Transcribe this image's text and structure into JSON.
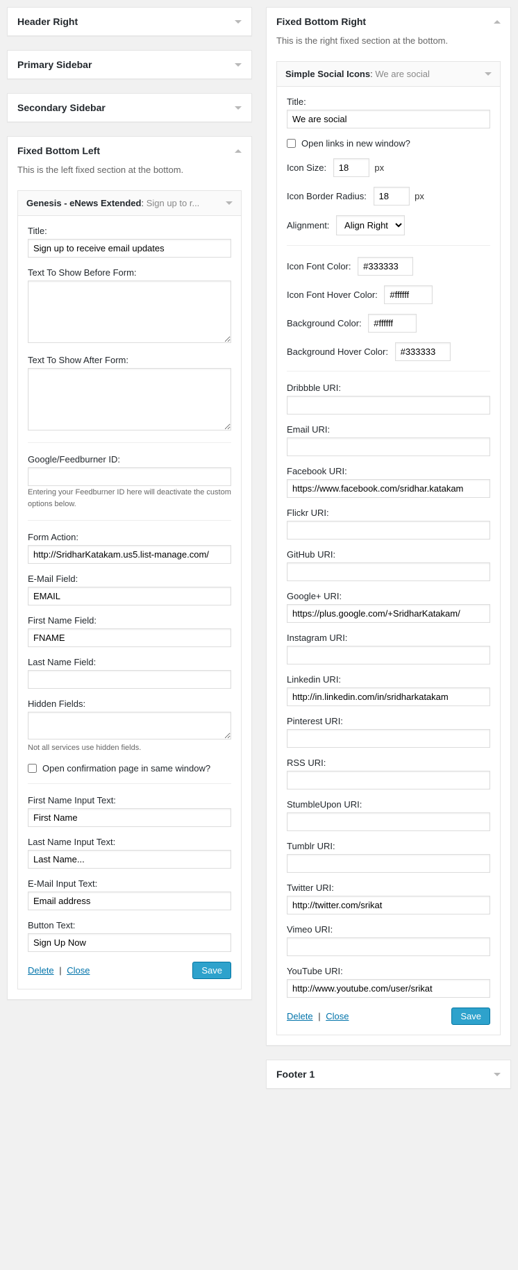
{
  "left": {
    "areas": {
      "header_right": {
        "title": "Header Right"
      },
      "primary_sidebar": {
        "title": "Primary Sidebar"
      },
      "secondary_sidebar": {
        "title": "Secondary Sidebar"
      },
      "fixed_bottom_left": {
        "title": "Fixed Bottom Left",
        "desc": "This is the left fixed section at the bottom."
      }
    },
    "enews": {
      "header_name": "Genesis - eNews Extended",
      "header_sub": "Sign up to r...",
      "labels": {
        "title": "Title:",
        "before": "Text To Show Before Form:",
        "after": "Text To Show After Form:",
        "feedburner": "Google/Feedburner ID:",
        "feedburner_help": "Entering your Feedburner ID here will deactivate the custom options below.",
        "form_action": "Form Action:",
        "email_field": "E-Mail Field:",
        "fname_field": "First Name Field:",
        "lname_field": "Last Name Field:",
        "hidden": "Hidden Fields:",
        "hidden_help": "Not all services use hidden fields.",
        "open_same": "Open confirmation page in same window?",
        "fname_text": "First Name Input Text:",
        "lname_text": "Last Name Input Text:",
        "email_text": "E-Mail Input Text:",
        "button_text": "Button Text:"
      },
      "values": {
        "title": "Sign up to receive email updates",
        "before": "",
        "after": "",
        "feedburner": "",
        "form_action": "http://SridharKatakam.us5.list-manage.com/",
        "email_field": "EMAIL",
        "fname_field": "FNAME",
        "lname_field": "",
        "hidden": "",
        "fname_text": "First Name",
        "lname_text": "Last Name...",
        "email_text": "Email address",
        "button_text": "Sign Up Now"
      },
      "actions": {
        "delete": "Delete",
        "close": "Close",
        "save": "Save"
      }
    }
  },
  "right": {
    "area": {
      "title": "Fixed Bottom Right",
      "desc": "This is the right fixed section at the bottom."
    },
    "social": {
      "header_name": "Simple Social Icons",
      "header_sub": "We are social",
      "labels": {
        "title": "Title:",
        "open_new": "Open links in new window?",
        "icon_size": "Icon Size:",
        "px": "px",
        "border_radius": "Icon Border Radius:",
        "alignment": "Alignment:",
        "font_color": "Icon Font Color:",
        "font_hover": "Icon Font Hover Color:",
        "bg_color": "Background Color:",
        "bg_hover": "Background Hover Color:",
        "dribbble": "Dribbble URI:",
        "email": "Email URI:",
        "facebook": "Facebook URI:",
        "flickr": "Flickr URI:",
        "github": "GitHub URI:",
        "gplus": "Google+ URI:",
        "instagram": "Instagram URI:",
        "linkedin": "Linkedin URI:",
        "pinterest": "Pinterest URI:",
        "rss": "RSS URI:",
        "stumble": "StumbleUpon URI:",
        "tumblr": "Tumblr URI:",
        "twitter": "Twitter URI:",
        "vimeo": "Vimeo URI:",
        "youtube": "YouTube URI:"
      },
      "values": {
        "title": "We are social",
        "icon_size": "18",
        "border_radius": "18",
        "alignment": "Align Right",
        "font_color": "#333333",
        "font_hover": "#ffffff",
        "bg_color": "#ffffff",
        "bg_hover": "#333333",
        "dribbble": "",
        "email": "",
        "facebook": "https://www.facebook.com/sridhar.katakam",
        "flickr": "",
        "github": "",
        "gplus": "https://plus.google.com/+SridharKatakam/",
        "instagram": "",
        "linkedin": "http://in.linkedin.com/in/sridharkatakam",
        "pinterest": "",
        "rss": "",
        "stumble": "",
        "tumblr": "",
        "twitter": "http://twitter.com/srikat",
        "vimeo": "",
        "youtube": "http://www.youtube.com/user/srikat"
      },
      "actions": {
        "delete": "Delete",
        "close": "Close",
        "save": "Save"
      }
    },
    "footer1": {
      "title": "Footer 1"
    }
  }
}
